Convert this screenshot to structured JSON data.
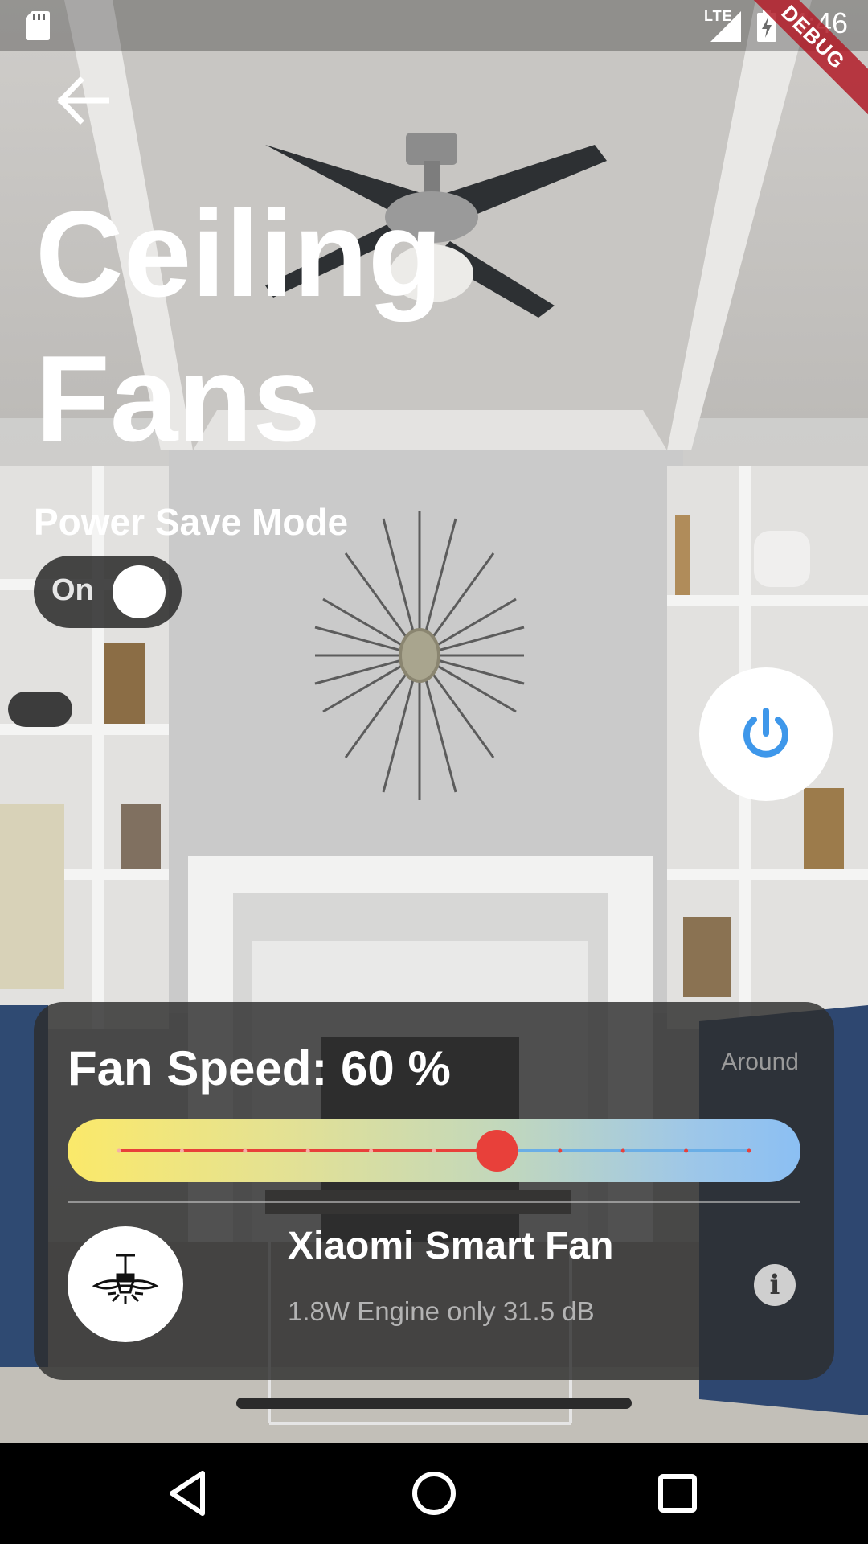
{
  "status_bar": {
    "time": "4:46",
    "network": "LTE",
    "debug_banner": "DEBUG"
  },
  "header": {
    "title": "Ceiling Fans"
  },
  "power_save": {
    "label": "Power Save Mode",
    "toggle_text": "On",
    "enabled": true
  },
  "fan_speed": {
    "label": "Fan Speed: 60 %",
    "hint": "Around",
    "value_percent": 60
  },
  "device": {
    "name": "Xiaomi Smart Fan",
    "description": "1.8W Engine only 31.5 dB"
  },
  "icons": {
    "back": "arrow-left-icon",
    "power": "power-icon",
    "info": "info-icon",
    "device": "ceiling-fan-icon",
    "nav": [
      "back-triangle-icon",
      "home-circle-icon",
      "recents-square-icon"
    ]
  },
  "colors": {
    "power_icon": "#3e97ea",
    "slider_thumb": "#e8403a",
    "slider_active_track": "#e8403a",
    "slider_inactive_track": "#6aaee6",
    "gradient_start": "#fbe96a",
    "gradient_end": "#8bbff3"
  }
}
